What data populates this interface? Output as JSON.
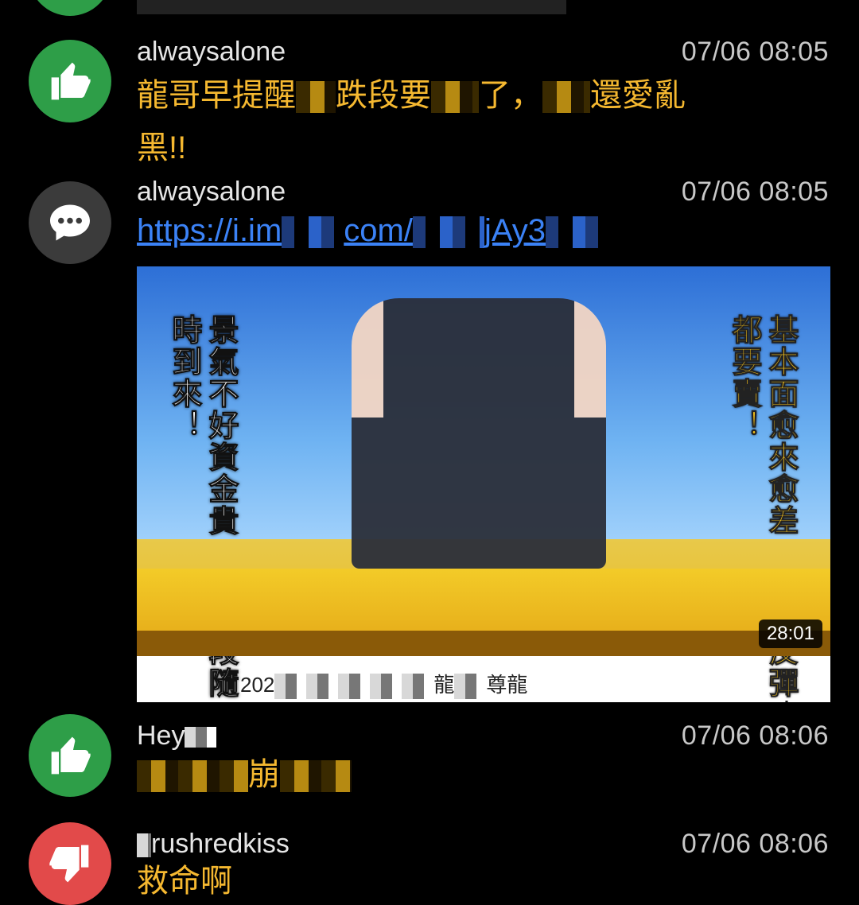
{
  "comments": [
    {
      "avatar_icon": "thumbs-up-icon",
      "avatar_color": "#2e9e48",
      "author": "alwaysalone",
      "time": "07/06 08:05",
      "line1_a": "龍哥早提醒",
      "line1_b": "跌段要",
      "line1_c": "了，",
      "line1_d": "還愛亂",
      "line2": "黑!!"
    },
    {
      "avatar_icon": "chat-bubble-icon",
      "avatar_color": "#3b3b3b",
      "author": "alwaysalone",
      "time": "07/06 08:05",
      "link_a": "https://i.im",
      "link_b": "com/",
      "link_c": "jAy3",
      "video": {
        "left_caption_col1": "景氣不好資金貴",
        "left_caption_col2": "主跌段隨時到來！",
        "right_caption_col1": "基本面愈來愈差",
        "right_caption_col2": "台股反彈都要賣！",
        "duration": "28:01",
        "title_a": "202",
        "title_b": "龍",
        "title_c": "尊龍"
      }
    },
    {
      "avatar_icon": "thumbs-up-icon",
      "avatar_color": "#2e9e48",
      "author": "Hey",
      "time": "07/06 08:06",
      "line1_a": "崩"
    },
    {
      "avatar_icon": "thumbs-down-icon",
      "avatar_color": "#e24a4a",
      "author": "rushredkiss",
      "time": "07/06 08:06",
      "line1_a": "救命啊"
    }
  ]
}
